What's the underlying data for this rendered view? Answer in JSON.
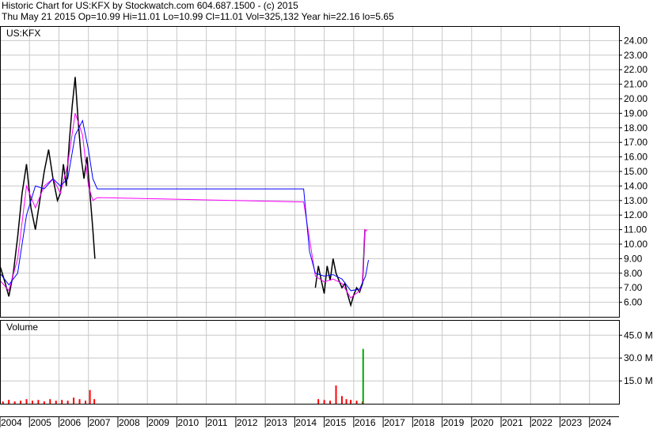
{
  "header": {
    "title_line": "Historic Chart for US:KFX by Stockwatch.com 604.687.1500 - (c) 2015",
    "quote_line": "Thu May 21 2015   Op=10.99   Hi=11.01   Lo=10.99   Cl=11.01   Vol=325,132   Year hi=22.16   lo=5.65"
  },
  "colors": {
    "price": "#000000",
    "ma_short": "#ff00ff",
    "ma_long": "#0000ff",
    "volume": "#ff0000",
    "volume_spike": "#00aa00",
    "grid": "#c8c8c8"
  },
  "chart_data": [
    {
      "type": "line",
      "panel": "price",
      "title": "US:KFX",
      "ylim": [
        5,
        25
      ],
      "yticks": [
        "24.00",
        "23.00",
        "22.00",
        "21.00",
        "20.00",
        "19.00",
        "18.00",
        "17.00",
        "16.00",
        "15.00",
        "14.00",
        "13.00",
        "12.00",
        "11.00",
        "10.00",
        "9.00",
        "8.00",
        "7.00",
        "6.00"
      ],
      "grid": true,
      "series": [
        {
          "role": "price",
          "x": [
            2004.0,
            2004.15,
            2004.3,
            2004.45,
            2004.6,
            2004.75,
            2004.9,
            2005.05,
            2005.2,
            2005.35,
            2005.5,
            2005.65,
            2005.8,
            2005.95,
            2006.05,
            2006.15,
            2006.25,
            2006.35,
            2006.45,
            2006.55,
            2006.65,
            2006.75,
            2006.85,
            2006.95,
            2007.05,
            2007.15,
            2007.22
          ],
          "values": [
            8.5,
            7.5,
            6.4,
            8.0,
            10.5,
            13.5,
            15.5,
            12.5,
            11.0,
            13.0,
            15.0,
            16.5,
            14.5,
            13.0,
            13.5,
            15.5,
            14.0,
            17.0,
            19.5,
            21.5,
            18.5,
            16.0,
            14.5,
            16.0,
            13.5,
            11.0,
            9.0
          ]
        },
        {
          "role": "price",
          "x": [
            2014.7,
            2014.8,
            2014.9,
            2015.0,
            2015.1,
            2015.2,
            2015.3,
            2015.4,
            2015.5,
            2015.6,
            2015.7,
            2015.8,
            2015.9,
            2016.0,
            2016.1,
            2016.2,
            2016.3,
            2016.38
          ],
          "values": [
            7.0,
            8.5,
            7.5,
            6.6,
            8.5,
            7.5,
            9.0,
            8.0,
            7.5,
            7.0,
            7.3,
            6.5,
            5.8,
            6.5,
            7.0,
            6.7,
            7.3,
            11.0
          ]
        },
        {
          "role": "ma_short",
          "x": [
            2004.0,
            2004.3,
            2004.6,
            2004.9,
            2005.2,
            2005.5,
            2005.8,
            2006.05,
            2006.3,
            2006.55,
            2006.8,
            2007.0,
            2007.15,
            2007.3,
            2014.3,
            2014.7,
            2015.0,
            2015.3,
            2015.6,
            2015.9,
            2016.2,
            2016.3,
            2016.38,
            2016.42,
            2016.46
          ],
          "values": [
            7.5,
            6.8,
            9.0,
            14.0,
            12.5,
            14.0,
            14.5,
            13.5,
            15.5,
            19.0,
            17.5,
            14.0,
            13.0,
            13.2,
            12.9,
            7.8,
            7.4,
            7.6,
            7.3,
            6.3,
            6.8,
            7.4,
            11.0,
            10.9,
            11.0
          ]
        },
        {
          "role": "ma_long",
          "x": [
            2004.0,
            2004.3,
            2004.6,
            2004.9,
            2005.2,
            2005.5,
            2005.8,
            2006.05,
            2006.3,
            2006.55,
            2006.8,
            2007.0,
            2007.15,
            2007.3,
            2014.3,
            2014.5,
            2014.7,
            2015.0,
            2015.3,
            2015.6,
            2015.9,
            2016.2,
            2016.4,
            2016.5
          ],
          "values": [
            8.0,
            7.2,
            8.0,
            12.0,
            14.0,
            13.8,
            14.5,
            14.0,
            14.5,
            17.5,
            18.5,
            16.5,
            14.5,
            13.8,
            13.8,
            9.5,
            8.0,
            7.8,
            7.9,
            7.6,
            6.8,
            6.9,
            7.8,
            8.9
          ]
        }
      ]
    },
    {
      "type": "bar",
      "panel": "volume",
      "title": "Volume",
      "ylim": [
        0,
        55
      ],
      "yticks": [
        "45.0 M",
        "30.0 M",
        "15.0 M"
      ],
      "xticks": [
        "2004",
        "2005",
        "2006",
        "2007",
        "2008",
        "2009",
        "2010",
        "2011",
        "2012",
        "2013",
        "2014",
        "2015",
        "2016",
        "2017",
        "2018",
        "2019",
        "2020",
        "2021",
        "2022",
        "2023",
        "2024"
      ],
      "x_range": [
        2004,
        2025
      ],
      "series": [
        {
          "role": "volume",
          "x": [
            2004.1,
            2004.3,
            2004.5,
            2004.7,
            2004.9,
            2005.1,
            2005.3,
            2005.5,
            2005.7,
            2005.9,
            2006.1,
            2006.3,
            2006.5,
            2006.7,
            2006.9,
            2007.05,
            2007.2,
            2014.8,
            2015.0,
            2015.2,
            2015.4,
            2015.6,
            2015.75,
            2015.9,
            2016.1,
            2016.3
          ],
          "values": [
            1.5,
            2.5,
            1.5,
            2.0,
            3.0,
            2.0,
            2.5,
            1.5,
            3.0,
            2.0,
            2.5,
            2.0,
            4.0,
            3.0,
            2.0,
            9.0,
            3.0,
            3.0,
            2.5,
            2.0,
            12.0,
            5.0,
            3.0,
            2.5,
            2.0,
            1.5
          ]
        },
        {
          "role": "volume_spike",
          "x": [
            2016.32
          ],
          "values": [
            36.0
          ]
        }
      ]
    }
  ]
}
